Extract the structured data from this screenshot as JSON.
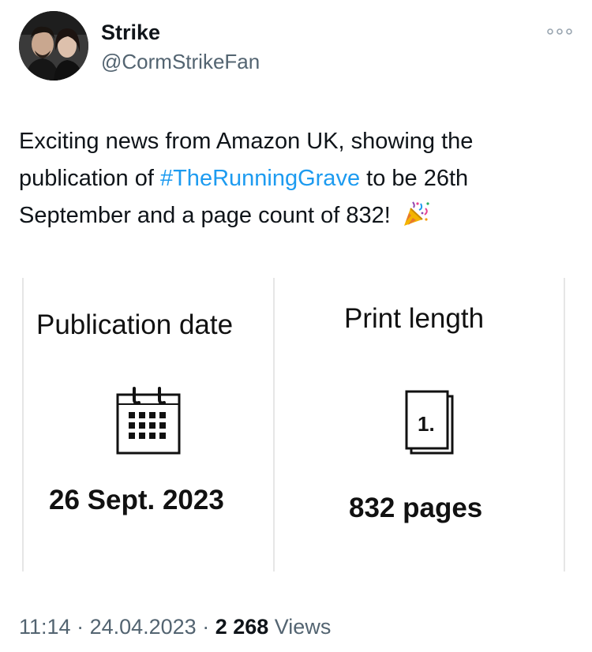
{
  "author": {
    "display_name": "Strike",
    "handle": "@CormStrikeFan"
  },
  "more_icon": "more-horizontal-icon",
  "tweet": {
    "text_part1": "Exciting news from Amazon UK, showing the\npublication of ",
    "hashtag": "#TheRunningGrave",
    "text_part2": " to be 26th\nSeptember and a page count of 832! ",
    "emoji": "party-popper-icon"
  },
  "image": {
    "publication": {
      "title": "Publication date",
      "icon": "calendar-icon",
      "value": "26 Sept. 2023"
    },
    "print": {
      "title": "Print length",
      "icon": "pages-icon",
      "icon_label": "1.",
      "value": "832 pages"
    }
  },
  "meta": {
    "time": "11:14",
    "sep1": " · ",
    "date": "24.04.2023",
    "sep2": " · ",
    "views_count": "2 268",
    "views_label": " Views"
  },
  "colors": {
    "link": "#1d9bf0",
    "secondary_text": "#536471"
  }
}
